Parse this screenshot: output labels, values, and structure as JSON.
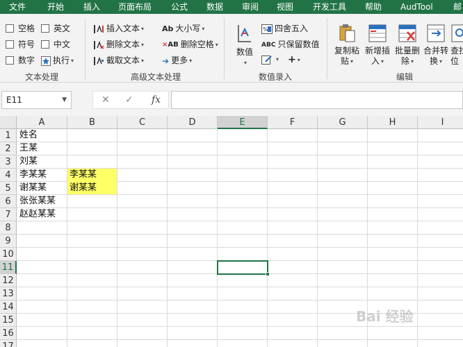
{
  "menu": [
    "文件",
    "开始",
    "插入",
    "页面布局",
    "公式",
    "数据",
    "审阅",
    "视图",
    "开发工具",
    "帮助",
    "AudTool",
    "邮"
  ],
  "ribbon": {
    "text_group": {
      "items": [
        "空格",
        "英文",
        "符号",
        "中文",
        "数字",
        "执行"
      ],
      "label": "文本处理"
    },
    "advanced_group": {
      "insert_text": "插入文本",
      "delete_text": "删除文本",
      "extract_text": "截取文本",
      "case": "大小写",
      "delete_space": "删除空格",
      "more": "更多",
      "label": "高级文本处理"
    },
    "number_group": {
      "number_btn": "数值",
      "round": "四舍五入",
      "keep_number": "只保留数值",
      "label": "数值录入"
    },
    "edit_group": {
      "copy_paste": [
        "复制粘",
        "贴"
      ],
      "insert_new": [
        "新增插",
        "入"
      ],
      "batch_delete": [
        "批量删",
        "除"
      ],
      "merge": [
        "合并转",
        "换"
      ],
      "find": [
        "查找",
        "位"
      ],
      "label": "编辑"
    }
  },
  "formula_bar": {
    "name_box": "E11",
    "cancel": "✕",
    "confirm": "✓",
    "fx": "fx",
    "content": ""
  },
  "grid": {
    "columns": [
      "A",
      "B",
      "C",
      "D",
      "E",
      "F",
      "G",
      "H",
      "I"
    ],
    "selected_column": "E",
    "rows": [
      "1",
      "2",
      "3",
      "4",
      "5",
      "6",
      "7",
      "8",
      "9",
      "10",
      "11",
      "12",
      "13",
      "14",
      "15",
      "16",
      "17"
    ],
    "selected_row": "11",
    "col_a": [
      "姓名",
      "王某",
      "刘某",
      "李某某",
      "谢某某",
      "张张某某",
      "赵赵某某"
    ],
    "col_b": [
      "",
      "",
      "",
      "李某某",
      "谢某某",
      "",
      ""
    ],
    "highlight_color": "#ffff66"
  },
  "watermark": "Bai 经验"
}
